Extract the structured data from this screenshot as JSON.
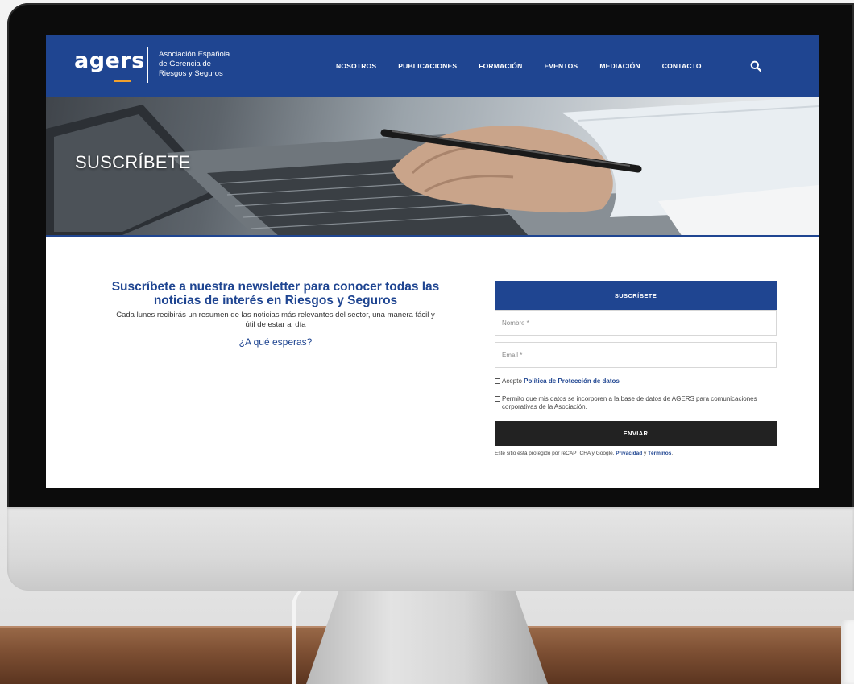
{
  "header": {
    "logo_word": "agers",
    "logo_lines": [
      "Asociación Española",
      "de Gerencia de",
      "Riesgos y Seguros"
    ],
    "nav": [
      "NOSOTROS",
      "PUBLICACIONES",
      "FORMACIÓN",
      "EVENTOS",
      "MEDIACIÓN",
      "CONTACTO"
    ],
    "search_icon": "search-icon",
    "brand_color": "#1f4591",
    "accent_color": "#f0a02d"
  },
  "hero": {
    "title": "SUSCRÍBETE"
  },
  "intro": {
    "heading": "Suscríbete a nuestra newsletter para conocer todas las noticias de interés en Riesgos y Seguros",
    "body": "Cada lunes recibirás un resumen de las noticias más relevantes del sector, una manera fácil y útil de estar al día",
    "cta": "¿A qué esperas?"
  },
  "form": {
    "title": "SUSCRÍBETE",
    "name_placeholder": "Nombre *",
    "email_placeholder": "Email *",
    "accept_prefix": "Acepto ",
    "accept_link": "Política de Protección de datos",
    "permit_text": "Permito que mis datos se incorporen a la base de datos de AGERS para comunicaciones corporativas de la Asociación.",
    "submit": "ENVIAR",
    "recaptcha_prefix": "Este sitio está protegido por reCAPTCHA y Google. ",
    "privacy_link": "Privacidad",
    "and": " y ",
    "terms_link": "Términos",
    "period": "."
  }
}
